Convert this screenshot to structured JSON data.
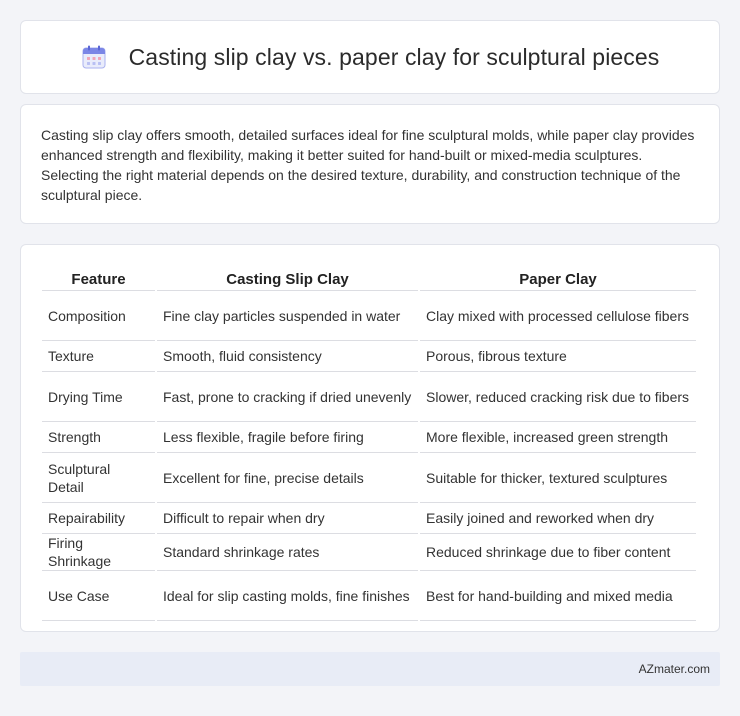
{
  "header": {
    "title": "Casting slip clay vs. paper clay for sculptural pieces",
    "icon": "calendar-icon"
  },
  "intro": {
    "text": "Casting slip clay offers smooth, detailed surfaces ideal for fine sculptural molds, while paper clay provides enhanced strength and flexibility, making it better suited for hand-built or mixed-media sculptures. Selecting the right material depends on the desired texture, durability, and construction technique of the sculptural piece."
  },
  "table": {
    "headers": [
      "Feature",
      "Casting Slip Clay",
      "Paper Clay"
    ],
    "rows": [
      [
        "Composition",
        "Fine clay particles suspended in water",
        "Clay mixed with processed cellulose fibers"
      ],
      [
        "Texture",
        "Smooth, fluid consistency",
        "Porous, fibrous texture"
      ],
      [
        "Drying Time",
        "Fast, prone to cracking if dried unevenly",
        "Slower, reduced cracking risk due to fibers"
      ],
      [
        "Strength",
        "Less flexible, fragile before firing",
        "More flexible, increased green strength"
      ],
      [
        "Sculptural Detail",
        "Excellent for fine, precise details",
        "Suitable for thicker, textured sculptures"
      ],
      [
        "Repairability",
        "Difficult to repair when dry",
        "Easily joined and reworked when dry"
      ],
      [
        "Firing Shrinkage",
        "Standard shrinkage rates",
        "Reduced shrinkage due to fiber content"
      ],
      [
        "Use Case",
        "Ideal for slip casting molds, fine finishes",
        "Best for hand-building and mixed media"
      ]
    ]
  },
  "footer": {
    "brand": "AZmater.com"
  },
  "colors": {
    "background": "#f3f4f8",
    "card": "#ffffff",
    "footer": "#e8ecf6",
    "icon_accent": "#7b86e6"
  }
}
